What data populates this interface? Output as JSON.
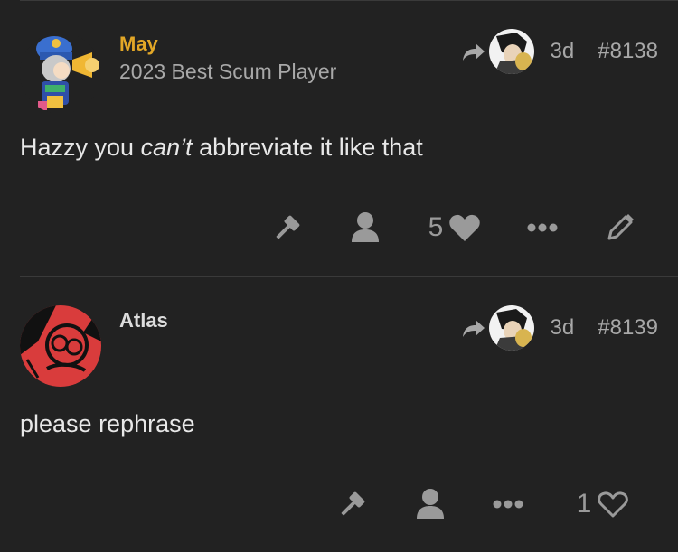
{
  "colors": {
    "background": "#222222",
    "username_may": "#e2a727",
    "username_atlas": "#dddddd",
    "muted": "#9a9a9a",
    "atlas_avatar": "#d93c3c"
  },
  "posts": [
    {
      "username": "May",
      "user_title": "2023 Best Scum Player",
      "avatar": "cartoon-megaphone-avatar",
      "reply_icon": "reply-arrow-icon",
      "age": "3d",
      "post_number": "#8138",
      "body": {
        "before": "Hazzy you ",
        "emphasis": "can’t",
        "after": " abbreviate it like that"
      },
      "actions": [
        "gavel-icon",
        "user-icon",
        "heart-icon",
        "more-icon",
        "edit-icon"
      ],
      "like_count": "5"
    },
    {
      "username": "Atlas",
      "user_title": "",
      "avatar": "red-character-avatar",
      "reply_icon": "reply-arrow-icon",
      "age": "3d",
      "post_number": "#8139",
      "body": {
        "text": "please rephrase"
      },
      "actions": [
        "gavel-icon",
        "user-icon",
        "more-icon",
        "heart-outline-icon"
      ],
      "like_count": "1"
    }
  ]
}
